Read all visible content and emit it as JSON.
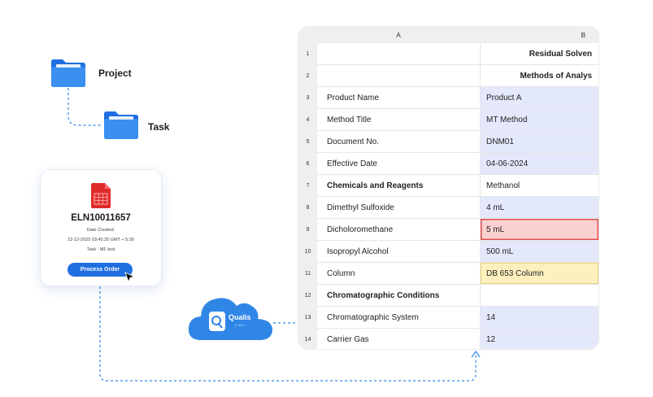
{
  "tree": {
    "project_label": "Project",
    "task_label": "Task"
  },
  "card": {
    "eln_id": "ELN10011657",
    "date_label": "Date Created:",
    "date_value": "22-12-2025 03:45:25 GMT + 5:30",
    "task_text": "Task : MF test",
    "button_label": "Process Order"
  },
  "cloud": {
    "brand": "Qualis",
    "sub": "LIMS",
    "color": "#2f86e6"
  },
  "sheet": {
    "col_a": "A",
    "col_b": "B",
    "rows": [
      {
        "num": "1",
        "a": "",
        "b": "Residual Solven"
      },
      {
        "num": "2",
        "a": "",
        "b": "Methods of Analys"
      },
      {
        "num": "3",
        "a": "Product Name",
        "b": "Product A"
      },
      {
        "num": "4",
        "a": "Method Title",
        "b": "MT Method"
      },
      {
        "num": "5",
        "a": "Document No.",
        "b": "DNM01"
      },
      {
        "num": "6",
        "a": "Effective Date",
        "b": "04-06-2024"
      },
      {
        "num": "7",
        "a": "Chemicals and Reagents",
        "b": "Methanol"
      },
      {
        "num": "8",
        "a": "Dimethyl Sulfoxide",
        "b": "4 mL"
      },
      {
        "num": "9",
        "a": "Dicholoromethane",
        "b": "5 mL"
      },
      {
        "num": "10",
        "a": "Isopropyl Alcohol",
        "b": "500 mL"
      },
      {
        "num": "11",
        "a": "Column",
        "b": "DB 653 Column"
      },
      {
        "num": "12",
        "a": "Chromatographic Conditions",
        "b": ""
      },
      {
        "num": "13",
        "a": "Chromatographic System",
        "b": "14"
      },
      {
        "num": "14",
        "a": "Carrier Gas",
        "b": "12"
      }
    ]
  },
  "colors": {
    "accent": "#1f6fe0",
    "folder": "#2f86e6",
    "highlight_lavender": "#e4e8fb",
    "highlight_error": "#fbd0d0",
    "highlight_warning": "#fdf0bd"
  }
}
